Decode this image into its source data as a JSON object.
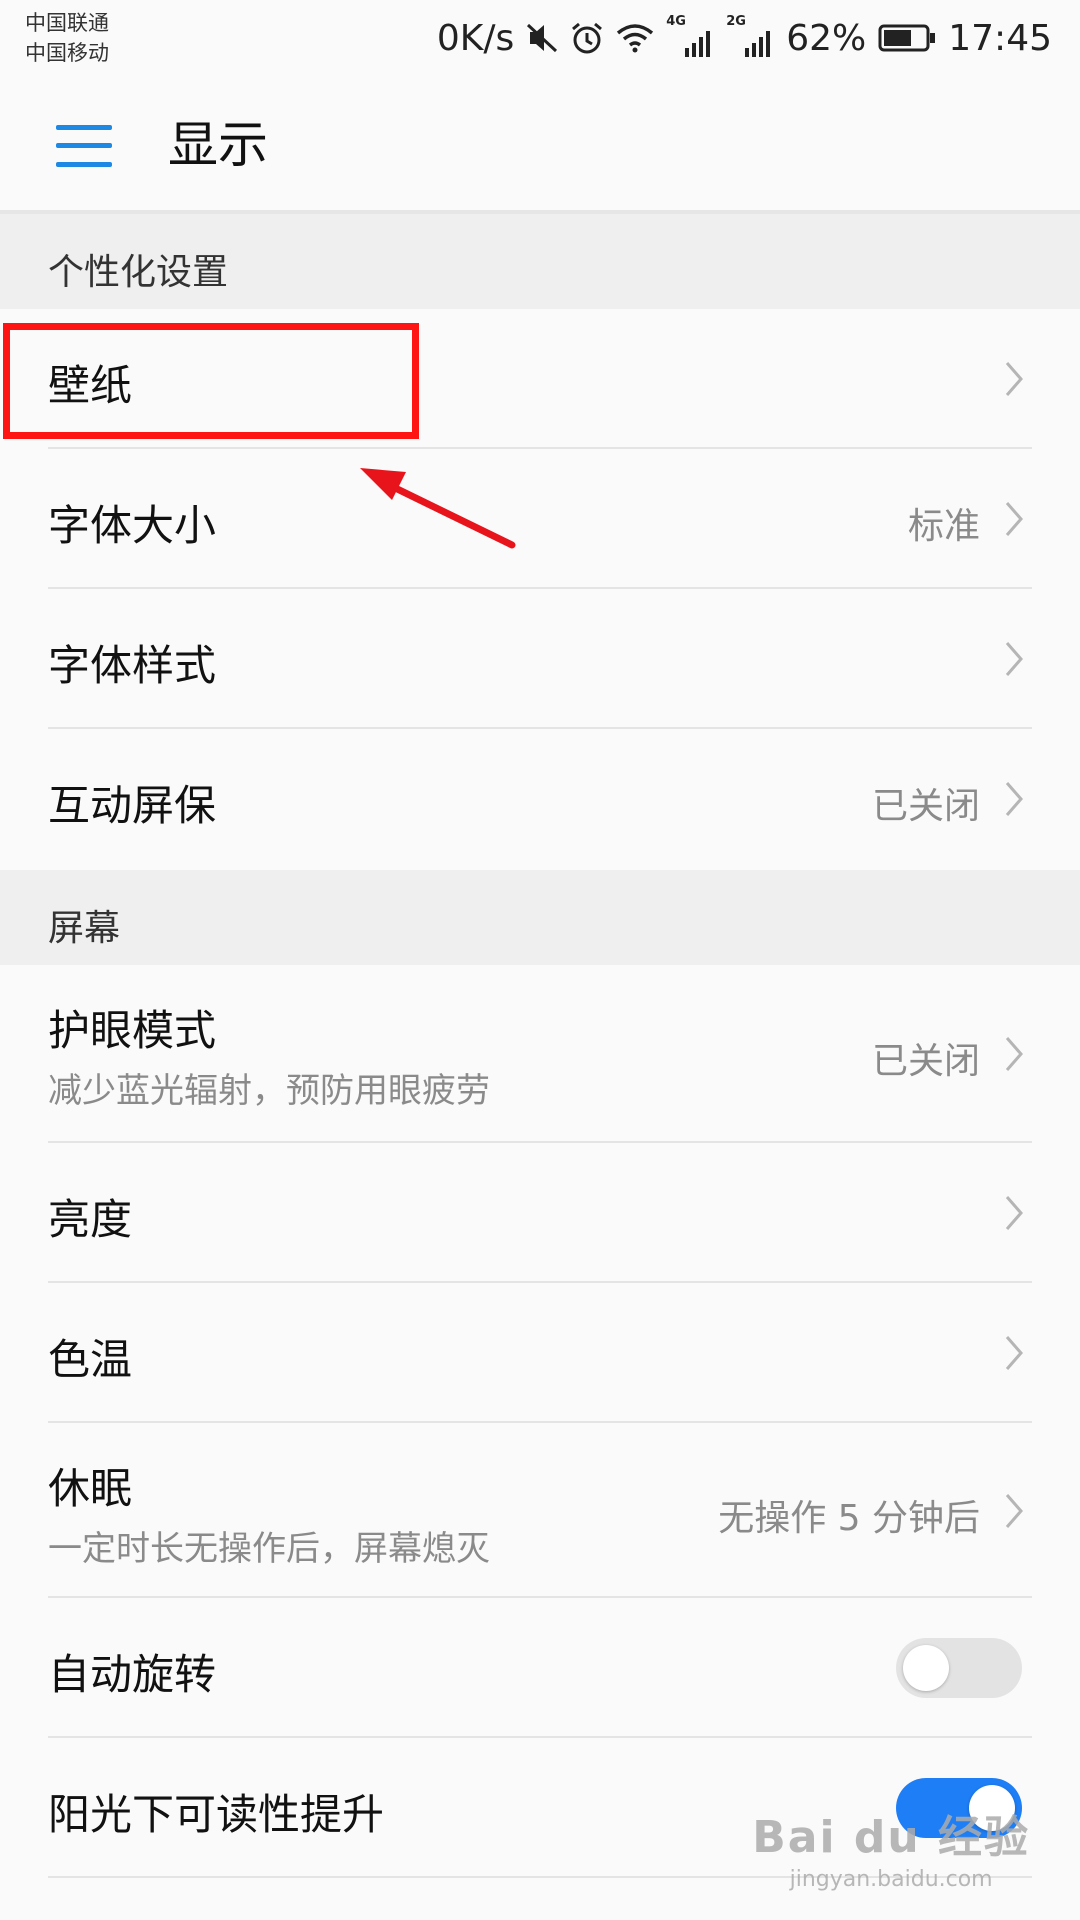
{
  "status_bar": {
    "carrier_1": "中国联通",
    "carrier_2": "中国移动",
    "speed": "0K/s",
    "network_1": "4G",
    "network_2": "2G",
    "battery_percent": "62%",
    "battery_level": 0.62,
    "time": "17:45",
    "icons": [
      "mute-icon",
      "alarm-icon",
      "wifi-icon",
      "signal-icon",
      "signal-icon",
      "battery-icon"
    ]
  },
  "header": {
    "title": "显示",
    "menu_icon": "hamburger-menu-icon",
    "accent_color": "#1e88e5"
  },
  "sections": [
    {
      "label": "个性化设置",
      "items": [
        {
          "title": "壁纸",
          "value": ""
        },
        {
          "title": "字体大小",
          "value": "标准"
        },
        {
          "title": "字体样式",
          "value": ""
        },
        {
          "title": "互动屏保",
          "value": "已关闭"
        }
      ]
    },
    {
      "label": "屏幕",
      "items": [
        {
          "title": "护眼模式",
          "subtitle": "减少蓝光辐射，预防用眼疲劳",
          "value": "已关闭"
        },
        {
          "title": "亮度",
          "value": ""
        },
        {
          "title": "色温",
          "value": ""
        },
        {
          "title": "休眠",
          "subtitle": "一定时长无操作后，屏幕熄灭",
          "value": "无操作 5 分钟后"
        },
        {
          "title": "自动旋转",
          "toggle": false
        },
        {
          "title": "阳光下可读性提升",
          "toggle": true
        }
      ]
    }
  ],
  "annotation": {
    "highlight_color": "#ff1414"
  },
  "watermark": {
    "main": "Bai du 经验",
    "sub": "jingyan.baidu.com"
  }
}
